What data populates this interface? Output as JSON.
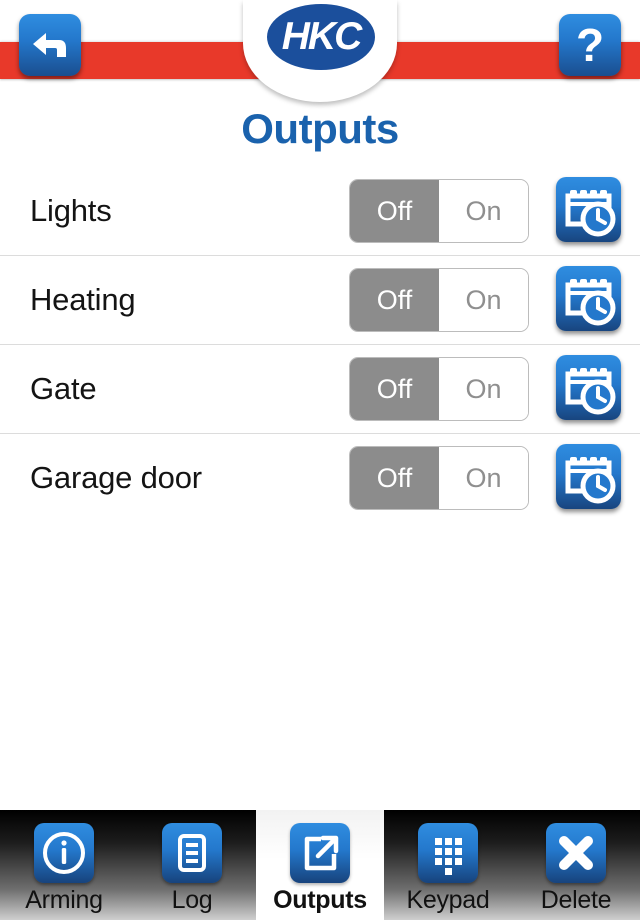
{
  "header": {
    "brand": "HKC",
    "back_label": "Back",
    "back_icon": "back-arrow-icon",
    "help_label": "?",
    "help_icon": "question-mark-icon",
    "band_color": "#e8392a",
    "brand_color": "#1b4f9c"
  },
  "page": {
    "title": "Outputs",
    "title_color": "#1a62ad"
  },
  "outputs": {
    "toggle_options": {
      "off": "Off",
      "on": "On"
    },
    "rows": [
      {
        "label": "Lights",
        "state": "Off",
        "schedule_icon": "calendar-clock-icon"
      },
      {
        "label": "Heating",
        "state": "Off",
        "schedule_icon": "calendar-clock-icon"
      },
      {
        "label": "Gate",
        "state": "Off",
        "schedule_icon": "calendar-clock-icon"
      },
      {
        "label": "Garage door",
        "state": "Off",
        "schedule_icon": "calendar-clock-icon"
      }
    ]
  },
  "tabbar": {
    "items": [
      {
        "label": "Arming",
        "icon": "info-circle-icon",
        "active": false
      },
      {
        "label": "Log",
        "icon": "document-list-icon",
        "active": false
      },
      {
        "label": "Outputs",
        "icon": "export-arrow-icon",
        "active": true
      },
      {
        "label": "Keypad",
        "icon": "dialpad-icon",
        "active": false
      },
      {
        "label": "Delete",
        "icon": "cross-x-icon",
        "active": false
      }
    ]
  }
}
